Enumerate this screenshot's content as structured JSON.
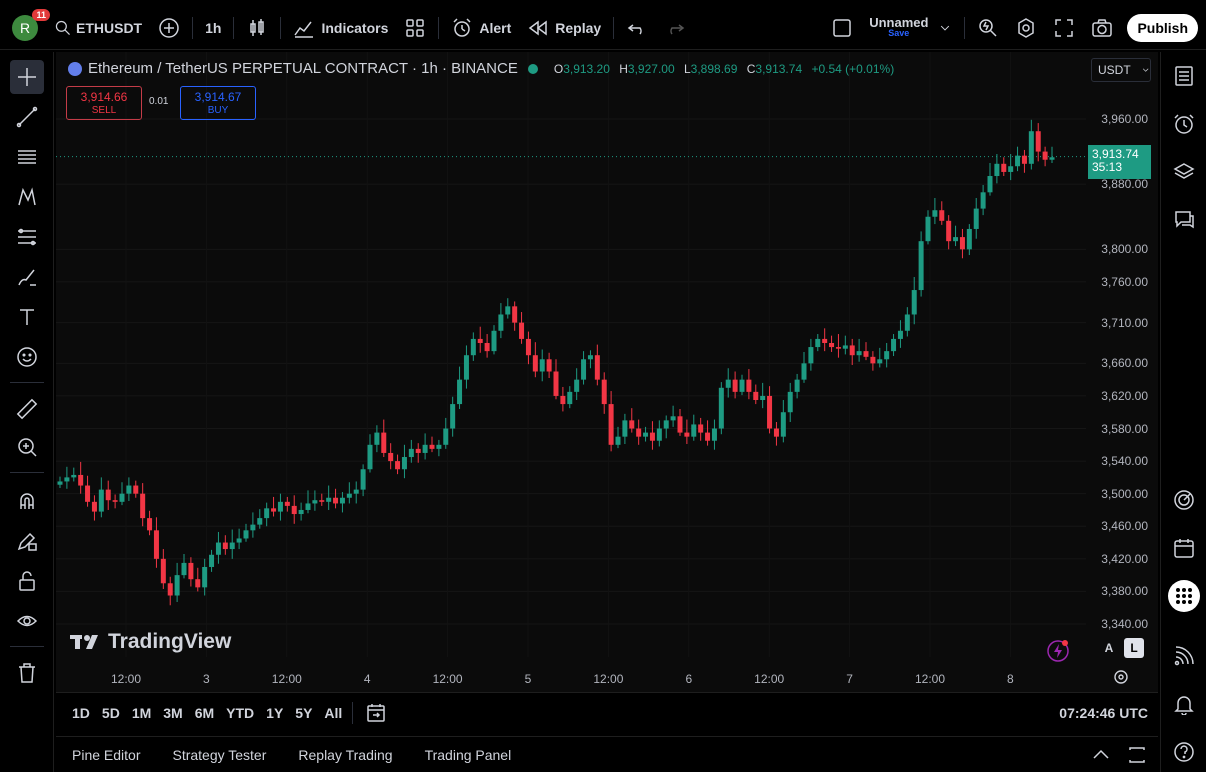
{
  "topbar": {
    "avatar_letter": "R",
    "avatar_badge": "11",
    "symbol": "ETHUSDT",
    "interval": "1h",
    "indicators_label": "Indicators",
    "alert_label": "Alert",
    "replay_label": "Replay",
    "layout_name": "Unnamed",
    "layout_save": "Save",
    "publish_label": "Publish"
  },
  "legend": {
    "title": "Ethereum / TetherUS PERPETUAL CONTRACT · 1h · BINANCE",
    "o_label": "O",
    "o_value": "3,913.20",
    "h_label": "H",
    "h_value": "3,927.00",
    "l_label": "L",
    "l_value": "3,898.69",
    "c_label": "C",
    "c_value": "3,913.74",
    "change": "+0.54 (+0.01%)"
  },
  "trade": {
    "sell_price": "3,914.66",
    "sell_label": "SELL",
    "spread": "0.01",
    "buy_price": "3,914.67",
    "buy_label": "BUY"
  },
  "currency": "USDT",
  "last_price": {
    "price": "3,913.74",
    "countdown": "35:13"
  },
  "watermark": "TradingView",
  "scale_buttons": {
    "auto": "A",
    "log": "L"
  },
  "chart_data": {
    "type": "candlestick",
    "price_ticks": [
      "3,960.00",
      "3,880.00",
      "3,800.00",
      "3,760.00",
      "3,710.00",
      "3,660.00",
      "3,620.00",
      "3,580.00",
      "3,540.00",
      "3,500.00",
      "3,460.00",
      "3,420.00",
      "3,380.00",
      "3,340.00"
    ],
    "price_tick_values": [
      3960,
      3880,
      3800,
      3760,
      3710,
      3660,
      3620,
      3580,
      3540,
      3500,
      3460,
      3420,
      3380,
      3340
    ],
    "time_labels": [
      "12:00",
      "3",
      "12:00",
      "4",
      "12:00",
      "5",
      "12:00",
      "6",
      "12:00",
      "7",
      "12:00",
      "8"
    ],
    "last_close": 3913.74,
    "up_color": "#1e9b83",
    "down_color": "#f23645",
    "closes": [
      3515,
      3520,
      3523,
      3510,
      3490,
      3478,
      3505,
      3492,
      3490,
      3500,
      3510,
      3500,
      3470,
      3455,
      3420,
      3390,
      3375,
      3400,
      3415,
      3395,
      3385,
      3410,
      3425,
      3440,
      3432,
      3440,
      3445,
      3455,
      3462,
      3470,
      3482,
      3478,
      3490,
      3485,
      3475,
      3480,
      3488,
      3492,
      3490,
      3495,
      3488,
      3495,
      3500,
      3505,
      3530,
      3560,
      3575,
      3550,
      3540,
      3530,
      3545,
      3555,
      3550,
      3560,
      3555,
      3560,
      3580,
      3610,
      3640,
      3670,
      3690,
      3685,
      3675,
      3700,
      3720,
      3730,
      3710,
      3690,
      3670,
      3650,
      3665,
      3650,
      3620,
      3610,
      3625,
      3640,
      3665,
      3670,
      3640,
      3610,
      3560,
      3570,
      3590,
      3580,
      3570,
      3575,
      3565,
      3580,
      3590,
      3595,
      3575,
      3570,
      3585,
      3575,
      3565,
      3580,
      3630,
      3640,
      3625,
      3640,
      3625,
      3615,
      3620,
      3580,
      3570,
      3600,
      3625,
      3640,
      3660,
      3680,
      3690,
      3685,
      3680,
      3678,
      3682,
      3670,
      3675,
      3668,
      3660,
      3665,
      3675,
      3690,
      3700,
      3720,
      3750,
      3810,
      3840,
      3848,
      3835,
      3810,
      3815,
      3800,
      3825,
      3850,
      3870,
      3890,
      3905,
      3895,
      3902,
      3915,
      3905,
      3945,
      3920,
      3910,
      3913
    ]
  },
  "rangebar": {
    "ranges": [
      "1D",
      "5D",
      "1M",
      "3M",
      "6M",
      "YTD",
      "1Y",
      "5Y",
      "All"
    ],
    "clock": "07:24:46 UTC"
  },
  "bottom_tabs": [
    "Pine Editor",
    "Strategy Tester",
    "Replay Trading",
    "Trading Panel"
  ]
}
